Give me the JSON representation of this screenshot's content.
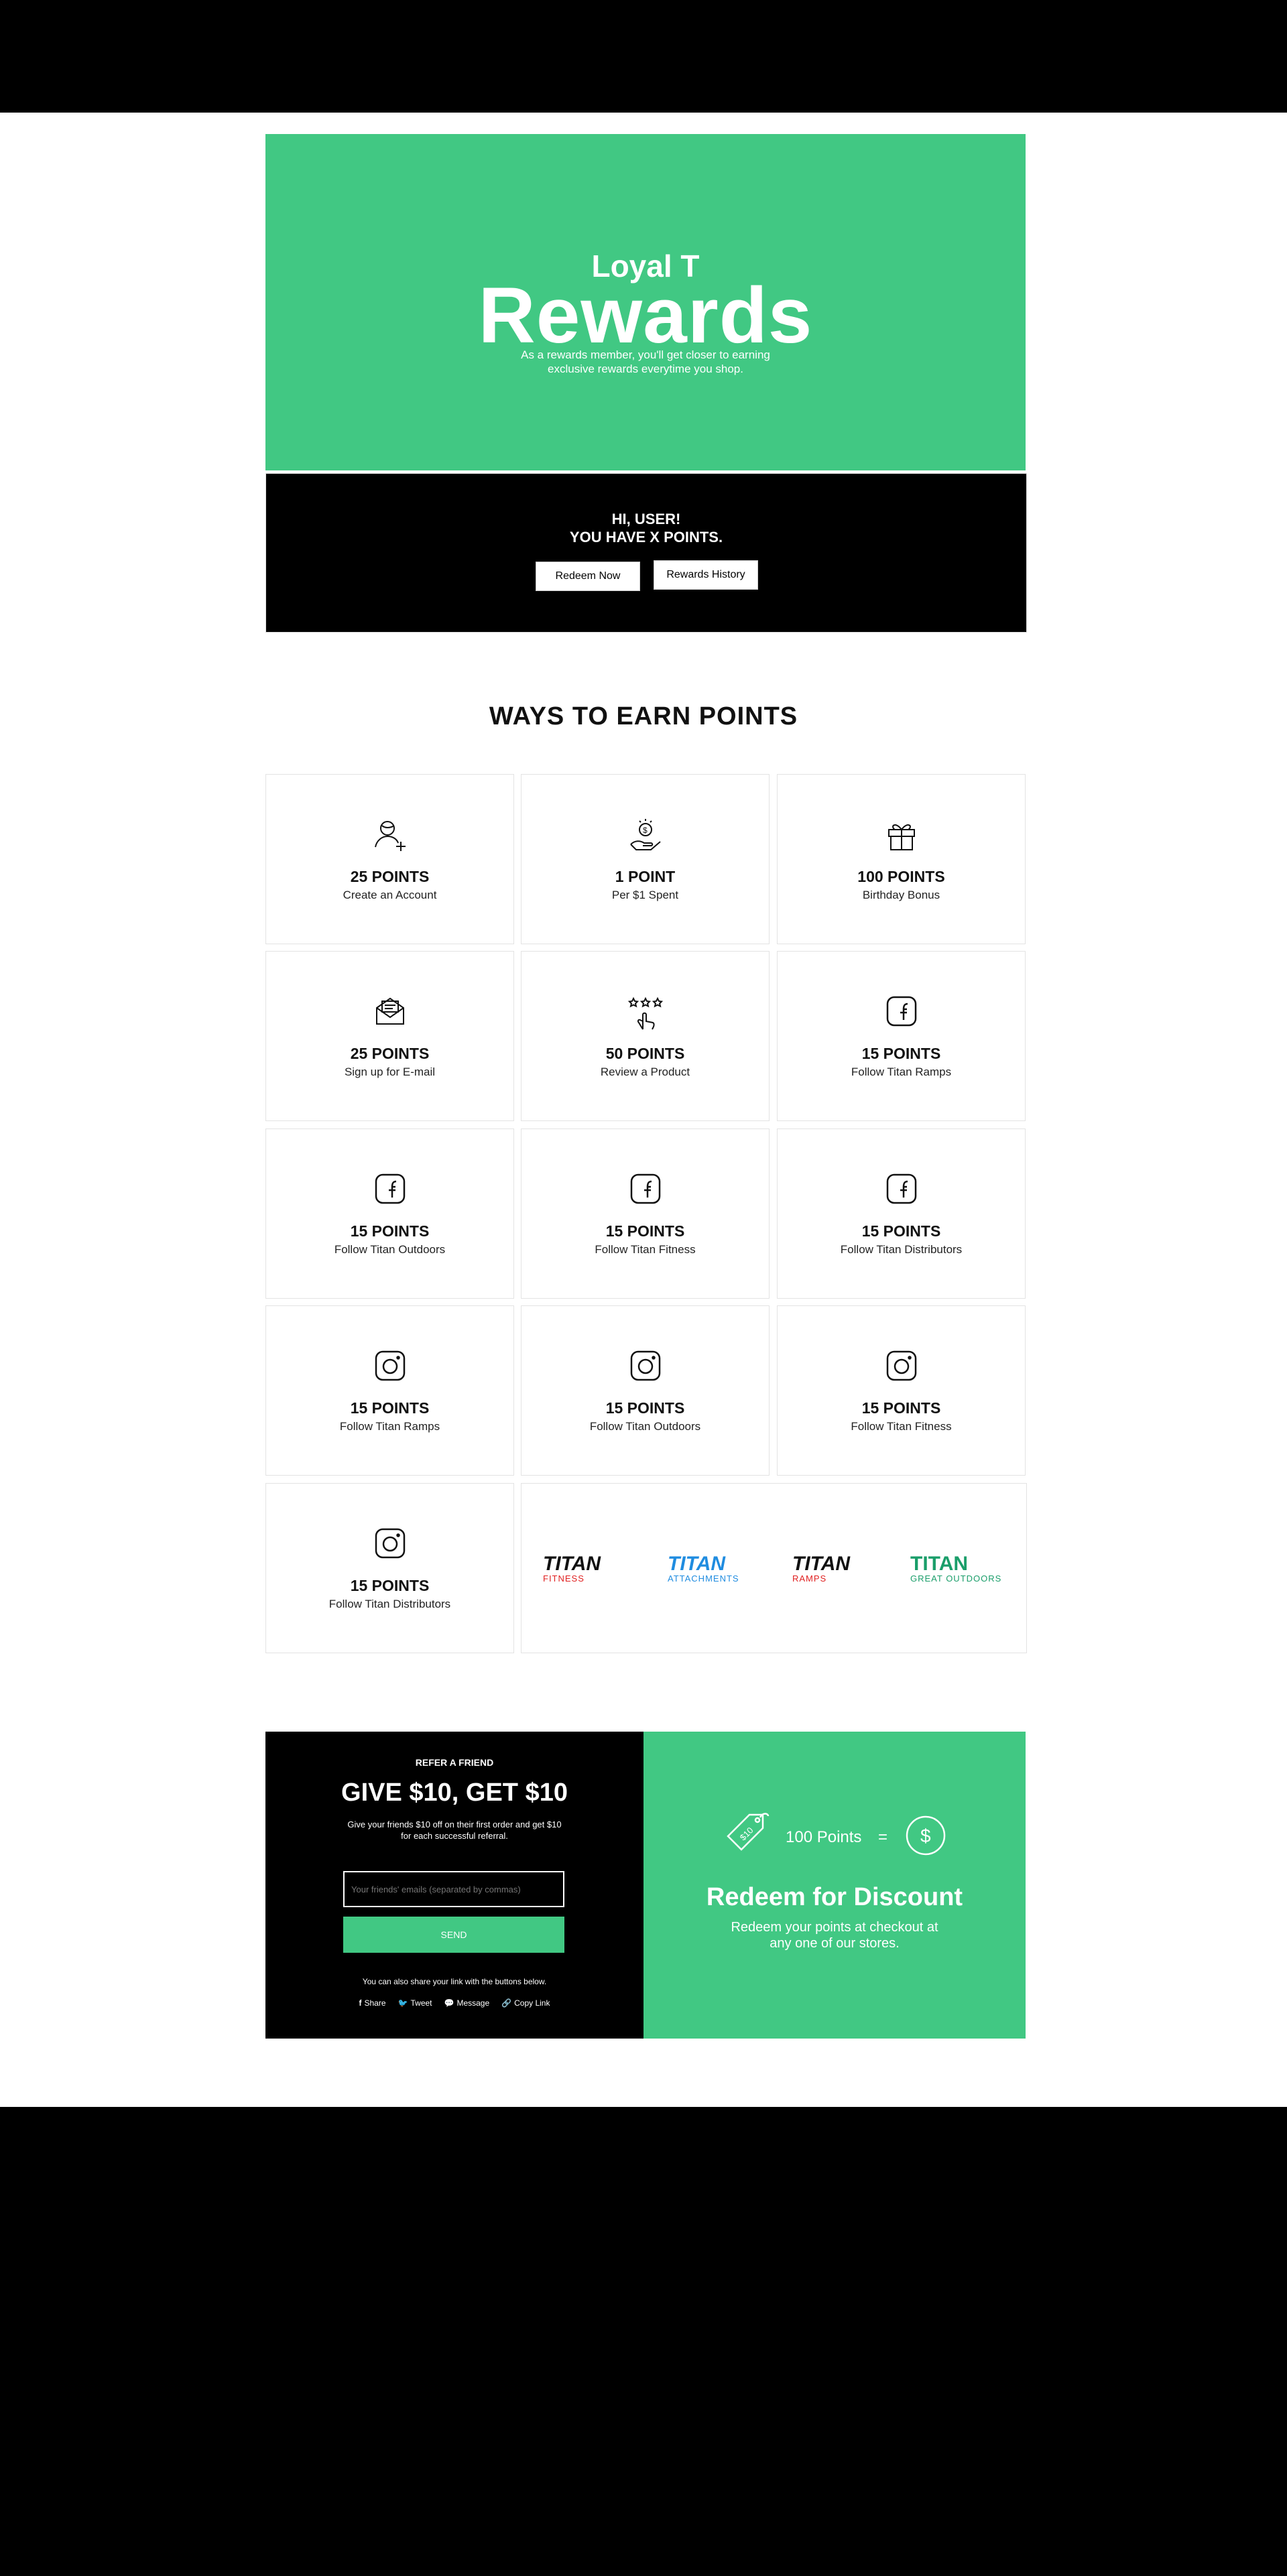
{
  "hero": {
    "small_title": "Loyal T",
    "big_title": "Rewards",
    "subtitle": "As a rewards member, you'll get closer to earning exclusive rewards everytime you shop."
  },
  "user": {
    "greeting_line1": "HI, USER!",
    "greeting_line2": "YOU HAVE X POINTS.",
    "redeem_button": "Redeem Now",
    "history_button": "Rewards History"
  },
  "earn": {
    "title": "WAYS TO EARN POINTS",
    "cards": [
      {
        "points": "25 POINTS",
        "desc": "Create an Account",
        "icon": "user-add-icon"
      },
      {
        "points": "1 POINT",
        "desc": "Per $1 Spent",
        "icon": "hand-coin-icon"
      },
      {
        "points": "100 POINTS",
        "desc": "Birthday Bonus",
        "icon": "gift-icon"
      },
      {
        "points": "25 POINTS",
        "desc": "Sign up for E-mail",
        "icon": "envelope-icon"
      },
      {
        "points": "50 POINTS",
        "desc": "Review a Product",
        "icon": "stars-click-icon"
      },
      {
        "points": "15 POINTS",
        "desc": "Follow Titan Ramps",
        "icon": "facebook-icon"
      },
      {
        "points": "15 POINTS",
        "desc": "Follow Titan Outdoors",
        "icon": "facebook-icon"
      },
      {
        "points": "15 POINTS",
        "desc": "Follow Titan Fitness",
        "icon": "facebook-icon"
      },
      {
        "points": "15 POINTS",
        "desc": "Follow Titan Distributors",
        "icon": "facebook-icon"
      },
      {
        "points": "15 POINTS",
        "desc": "Follow Titan Ramps",
        "icon": "instagram-icon"
      },
      {
        "points": "15 POINTS",
        "desc": "Follow Titan Outdoors",
        "icon": "instagram-icon"
      },
      {
        "points": "15 POINTS",
        "desc": "Follow Titan Fitness",
        "icon": "instagram-icon"
      },
      {
        "points": "15 POINTS",
        "desc": "Follow Titan Distributors",
        "icon": "instagram-icon"
      }
    ],
    "logos": [
      {
        "main": "TITAN",
        "sub": "FITNESS",
        "color": "#111111",
        "sub_color": "#e02020"
      },
      {
        "main": "TITAN",
        "sub": "ATTACHMENTS",
        "color": "#1f8ce0",
        "sub_color": "#1f8ce0"
      },
      {
        "main": "TITAN",
        "sub": "RAMPS",
        "color": "#111111",
        "sub_color": "#e02020"
      },
      {
        "main": "TITAN",
        "sub": "GREAT OUTDOORS",
        "color": "#1a9e6a",
        "sub_color": "#1a9e6a"
      }
    ]
  },
  "refer": {
    "kicker": "REFER A FRIEND",
    "headline": "GIVE $10, GET $10",
    "text": "Give your friends $10 off on their first order and get $10 for each successful referral.",
    "email_placeholder": "Your friends' emails (separated by commas)",
    "send_label": "SEND",
    "also": "You can also share your link with the buttons below.",
    "share": {
      "share": "Share",
      "tweet": "Tweet",
      "message": "Message",
      "copy": "Copy Link"
    }
  },
  "redeem": {
    "tag_text": "$10",
    "points_label": "100 Points",
    "equals": "=",
    "dollar": "$",
    "title": "Redeem for Discount",
    "desc": "Redeem your points at checkout at any one of our stores."
  },
  "colors": {
    "brand_green": "#41c883",
    "black": "#000000"
  }
}
